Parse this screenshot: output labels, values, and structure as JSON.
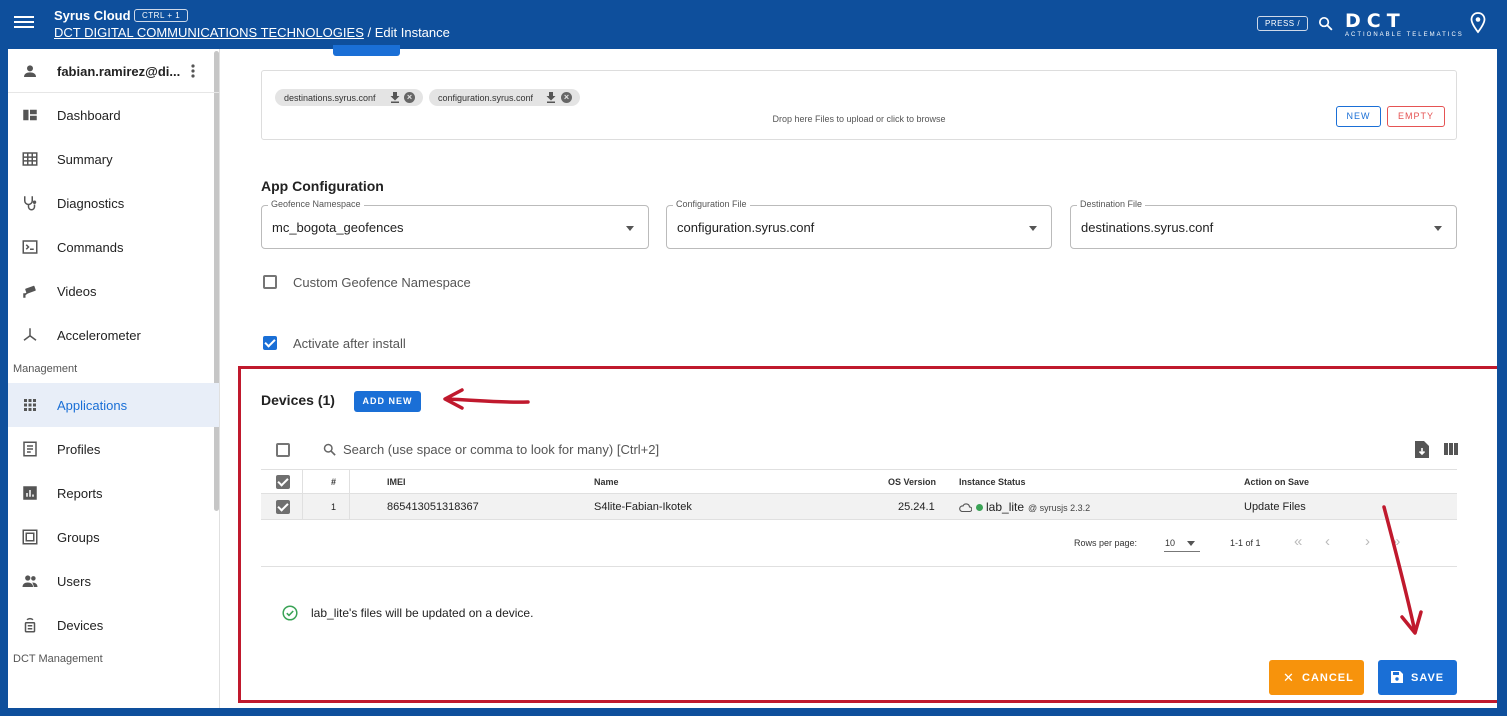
{
  "header": {
    "app_name": "Syrus Cloud",
    "shortcut": "CTRL + 1",
    "breadcrumb_link": "DCT DIGITAL COMMUNICATIONS TECHNOLOGIES",
    "breadcrumb_sep": " / ",
    "breadcrumb_current": "Edit Instance",
    "press_hint": "PRESS /",
    "logo_text": "DCT",
    "logo_sub": "ACTIONABLE TELEMATICS"
  },
  "sidebar": {
    "user": "fabian.ramirez@di...",
    "items": [
      {
        "label": "Dashboard",
        "icon": "dashboard-icon"
      },
      {
        "label": "Summary",
        "icon": "table-icon"
      },
      {
        "label": "Diagnostics",
        "icon": "stethoscope-icon"
      },
      {
        "label": "Commands",
        "icon": "terminal-icon"
      },
      {
        "label": "Videos",
        "icon": "camera-icon"
      },
      {
        "label": "Accelerometer",
        "icon": "axis-icon"
      }
    ],
    "section_management": "Management",
    "management_items": [
      {
        "label": "Applications",
        "icon": "apps-icon",
        "active": true
      },
      {
        "label": "Profiles",
        "icon": "profile-icon"
      },
      {
        "label": "Reports",
        "icon": "chart-icon"
      },
      {
        "label": "Groups",
        "icon": "groups-icon"
      },
      {
        "label": "Users",
        "icon": "users-icon"
      },
      {
        "label": "Devices",
        "icon": "device-icon"
      }
    ],
    "section_dct": "DCT Management"
  },
  "files": {
    "chips": [
      "destinations.syrus.conf",
      "configuration.syrus.conf"
    ],
    "drop_text": "Drop here Files to upload or click to browse",
    "new_label": "NEW",
    "empty_label": "EMPTY"
  },
  "app_config": {
    "title": "App Configuration",
    "fields": [
      {
        "label": "Geofence Namespace",
        "value": "mc_bogota_geofences"
      },
      {
        "label": "Configuration File",
        "value": "configuration.syrus.conf"
      },
      {
        "label": "Destination File",
        "value": "destinations.syrus.conf"
      }
    ],
    "custom_ns_label": "Custom Geofence Namespace",
    "custom_ns_checked": false,
    "activate_label": "Activate after install",
    "activate_checked": true
  },
  "devices": {
    "title": "Devices (1)",
    "add_new_label": "ADD NEW",
    "search_placeholder": "Search (use space or comma to look for many) [Ctrl+2]",
    "columns": [
      "#",
      "IMEI",
      "Name",
      "OS Version",
      "Instance Status",
      "Action on Save"
    ],
    "rows": [
      {
        "num": "1",
        "imei": "865413051318367",
        "name": "S4lite-Fabian-Ikotek",
        "os": "25.24.1",
        "status": "lab_lite",
        "status_suffix": "@ syrusjs 2.3.2",
        "action": "Update Files",
        "checked": true
      }
    ],
    "rows_per_page_label": "Rows per page:",
    "rows_per_page": "10",
    "range": "1-1 of 1",
    "message": "lab_lite's files will be updated on a device."
  },
  "actions": {
    "cancel_label": "CANCEL",
    "save_label": "SAVE"
  },
  "colors": {
    "brand": "#0e4f9c",
    "primary": "#1a6fd6",
    "cancel": "#f7930c",
    "annotation": "#c0192d",
    "success": "#3aa356"
  }
}
